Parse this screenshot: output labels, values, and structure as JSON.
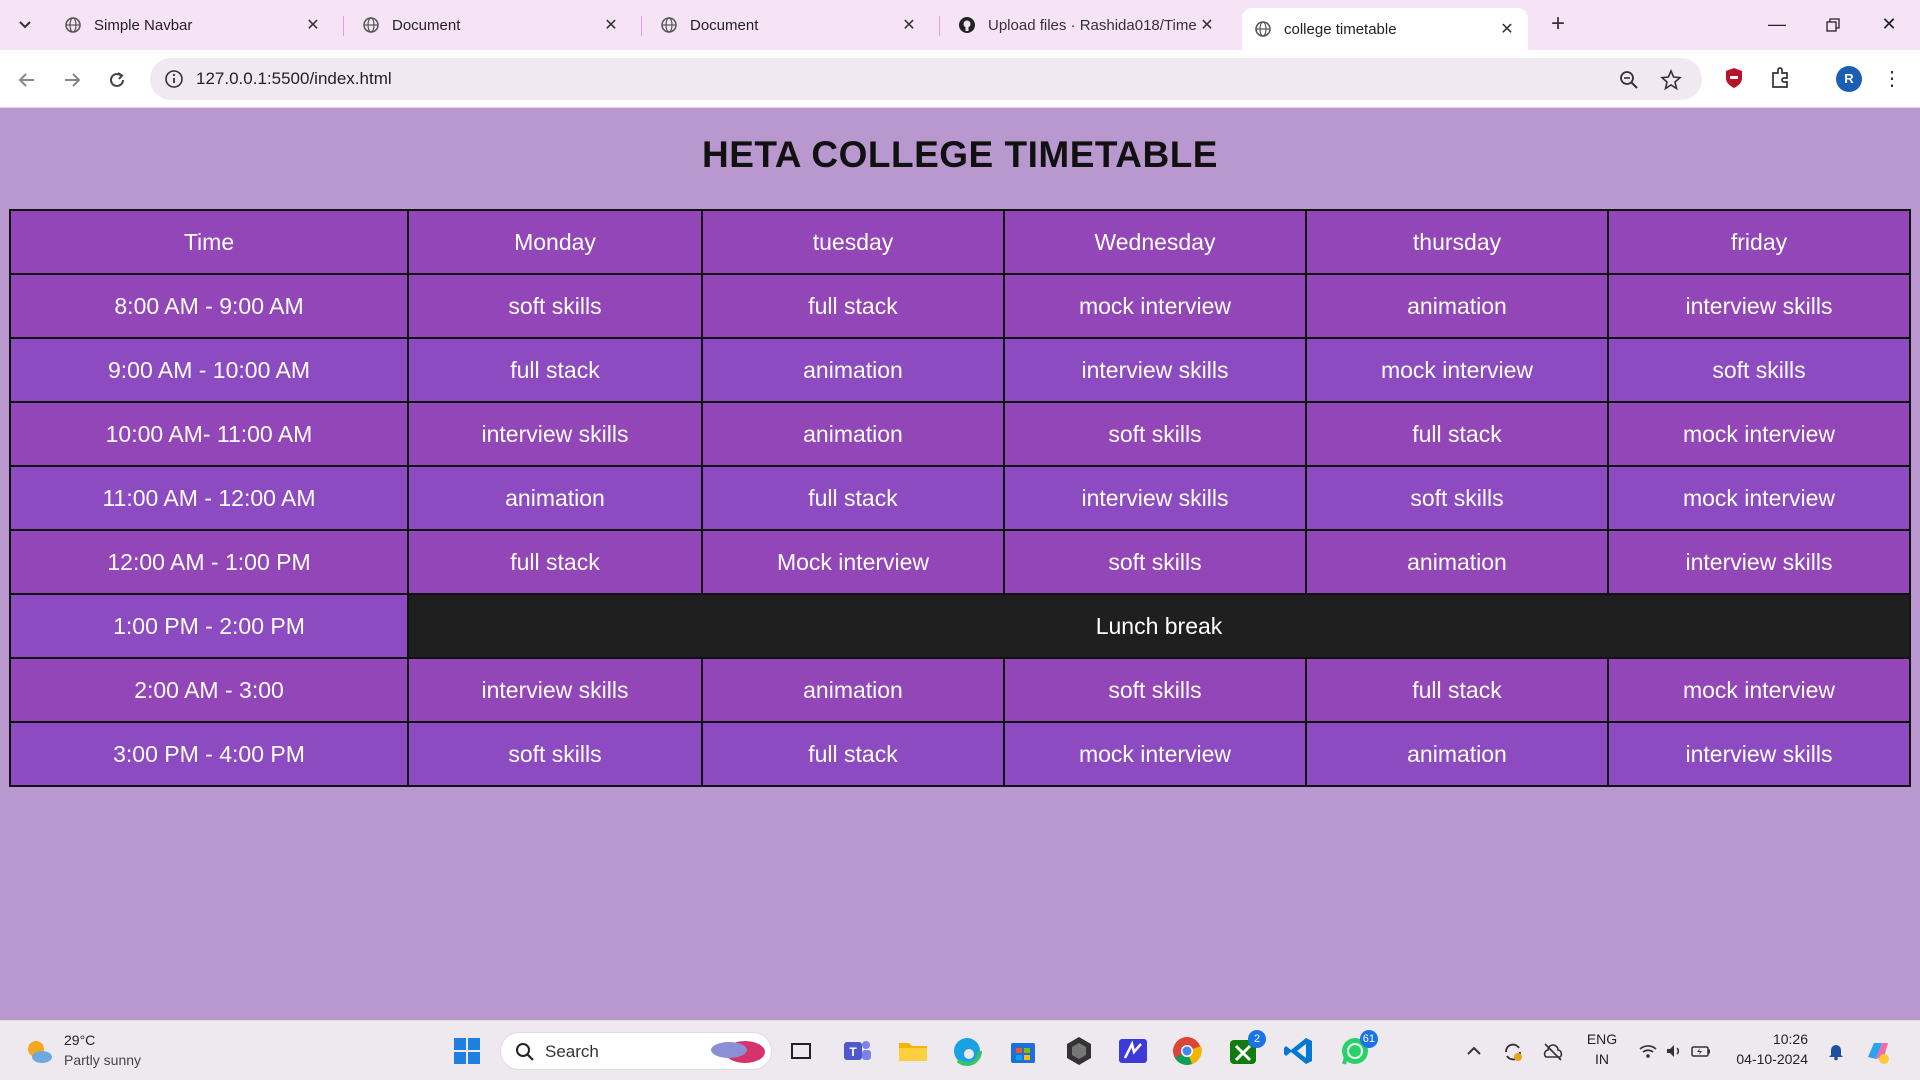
{
  "browser": {
    "tabs": [
      {
        "title": "Simple Navbar"
      },
      {
        "title": "Document"
      },
      {
        "title": "Document"
      },
      {
        "title": "Upload files · Rashida018/Time"
      },
      {
        "title": "college timetable"
      }
    ],
    "url": "127.0.0.1:5500/index.html",
    "profile_initial": "R"
  },
  "page": {
    "title": "HETA COLLEGE TIMETABLE",
    "headers": [
      "Time",
      "Monday",
      "tuesday",
      "Wednesday",
      "thursday",
      "friday"
    ],
    "rows": [
      {
        "time": "8:00 AM - 9:00 AM",
        "slots": [
          "soft skills",
          "full stack",
          "mock interview",
          "animation",
          "interview skills"
        ]
      },
      {
        "time": "9:00 AM - 10:00 AM",
        "slots": [
          "full stack",
          "animation",
          "interview skills",
          "mock interview",
          "soft skills"
        ]
      },
      {
        "time": "10:00 AM- 11:00 AM",
        "slots": [
          "interview skills",
          "animation",
          "soft skills",
          "full stack",
          "mock interview"
        ]
      },
      {
        "time": "11:00 AM - 12:00 AM",
        "slots": [
          "animation",
          "full stack",
          "interview skills",
          "soft skills",
          "mock interview"
        ]
      },
      {
        "time": "12:00 AM - 1:00 PM",
        "slots": [
          "full stack",
          "Mock interview",
          "soft skills",
          "animation",
          "interview skills"
        ]
      },
      {
        "time": "1:00 PM - 2:00 PM",
        "lunch": "Lunch break"
      },
      {
        "time": "2:00 AM - 3:00",
        "slots": [
          "interview skills",
          "animation",
          "soft skills",
          "full stack",
          "mock interview"
        ]
      },
      {
        "time": "3:00 PM - 4:00 PM",
        "slots": [
          "soft skills",
          "full stack",
          "mock interview",
          "animation",
          "interview skills"
        ]
      }
    ],
    "colors": {
      "cell_a": "#9246b8",
      "cell_b": "#8d4bc1",
      "lunch": "#1f1f1f",
      "background": "#b898cf"
    }
  },
  "taskbar": {
    "weather_temp": "29°C",
    "weather_desc": "Partly sunny",
    "search_label": "Search",
    "teams_badge": "2",
    "whatsapp_badge": "61",
    "lang_top": "ENG",
    "lang_bottom": "IN",
    "time": "10:26",
    "date": "04-10-2024"
  }
}
